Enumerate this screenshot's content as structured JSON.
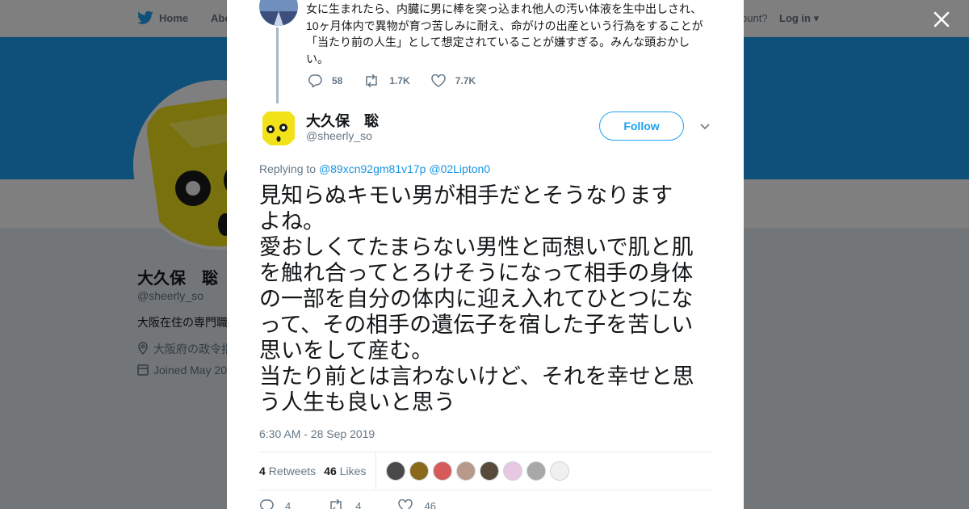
{
  "topnav": {
    "home_label": "Home",
    "about_label": "Abo",
    "account_text": "ccount?",
    "login_label": "Log in"
  },
  "background_profile": {
    "name": "大久保　聡",
    "handle": "@sheerly_so",
    "bio": "大阪在住の専門職",
    "location": "大阪府の政令指",
    "joined": "Joined May 20"
  },
  "parent_tweet": {
    "text": "女に生まれたら、内臓に男に棒を突っ込まれ他人の汚い体液を生中出しされ、\n10ヶ月体内で異物が育つ苦しみに耐え、命がけの出産という行為をすることが\n「当たり前の人生」として想定されていることが嫌すぎる。みんな頭おかし\nい。",
    "replies": "58",
    "retweets": "1.7K",
    "likes": "7.7K"
  },
  "tweet": {
    "name": "大久保　聡",
    "handle": "@sheerly_so",
    "follow_label": "Follow",
    "replying_prefix": "Replying to",
    "replying_to": [
      "@89xcn92gm81v17p",
      "@02Lipton0"
    ],
    "text": "見知らぬキモい男が相手だとそうなります\nよね。\n愛おしくてたまらない男性と両想いで肌と肌\nを触れ合ってとろけそうになって相手の身体\nの一部を自分の体内に迎え入れてひとつにな\nって、その相手の遺伝子を宿した子を苦しい\n思いをして産む。\n当たり前とは言わないけど、それを幸せと思\nう人生も良いと思う",
    "timestamp": "6:30 AM - 28 Sep 2019",
    "retweets_count": "4",
    "retweets_label": "Retweets",
    "likes_count": "46",
    "likes_label": "Likes",
    "action_replies": "4",
    "action_retweets": "4",
    "action_likes": "46"
  },
  "colors": {
    "brand": "#1da1f2",
    "link": "#1b95e0",
    "muted": "#657786"
  },
  "liker_avatar_colors": [
    "#4a4a4a",
    "#8a6a1a",
    "#d65a5a",
    "#b89a8a",
    "#5a4a3a",
    "#e8c8e0",
    "#a8a8a8",
    "#f0f0f0"
  ]
}
